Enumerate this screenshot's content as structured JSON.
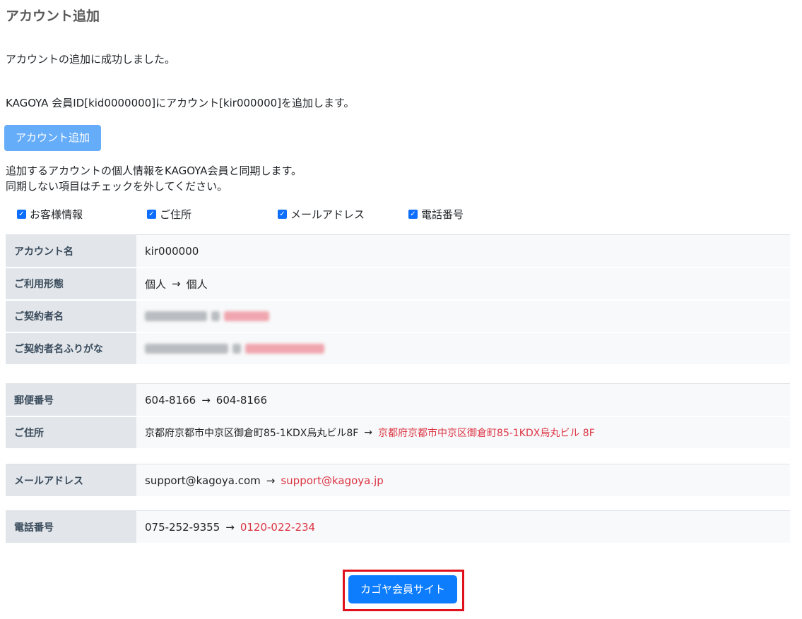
{
  "page": {
    "title": "アカウント追加",
    "success_message": "アカウントの追加に成功しました。",
    "info_message": "KAGOYA 会員ID[kid0000000]にアカウント[kir000000]を追加します。",
    "add_button_label": "アカウント追加",
    "note_line1": "追加するアカウントの個人情報をKAGOYA会員と同期します。",
    "note_line2": "同期しない項目はチェックを外してください。"
  },
  "checkboxes": [
    {
      "label": "お客様情報",
      "checked": true
    },
    {
      "label": "ご住所",
      "checked": true
    },
    {
      "label": "メールアドレス",
      "checked": true
    },
    {
      "label": "電話番号",
      "checked": true
    }
  ],
  "table": {
    "account_name": {
      "label": "アカウント名",
      "value": "kir000000"
    },
    "usage_type": {
      "label": "ご利用形態",
      "old": "個人",
      "arrow": "→",
      "new": "個人"
    },
    "contractor_name": {
      "label": "ご契約者名"
    },
    "contractor_kana": {
      "label": "ご契約者名ふりがな"
    },
    "postal_code": {
      "label": "郵便番号",
      "old": "604-8166",
      "arrow": "→",
      "new": "604-8166"
    },
    "address": {
      "label": "ご住所",
      "old": "京都府京都市中京区御倉町85-1KDX烏丸ビル8F",
      "arrow": "→",
      "new": "京都府京都市中京区御倉町85-1KDX烏丸ビル 8F"
    },
    "email": {
      "label": "メールアドレス",
      "old": "support@kagoya.com",
      "arrow": "→",
      "new": "support@kagoya.jp"
    },
    "phone": {
      "label": "電話番号",
      "old": "075-252-9355",
      "arrow": "→",
      "new": "0120-022-234"
    }
  },
  "footer": {
    "site_button_label": "カゴヤ会員サイト"
  },
  "colors": {
    "accent": "#0d7dfd",
    "changed_value": "#dc3545",
    "highlight_border": "#e0101c"
  },
  "icons": {
    "checkbox": "check-icon",
    "arrow": "arrow-right-icon"
  }
}
